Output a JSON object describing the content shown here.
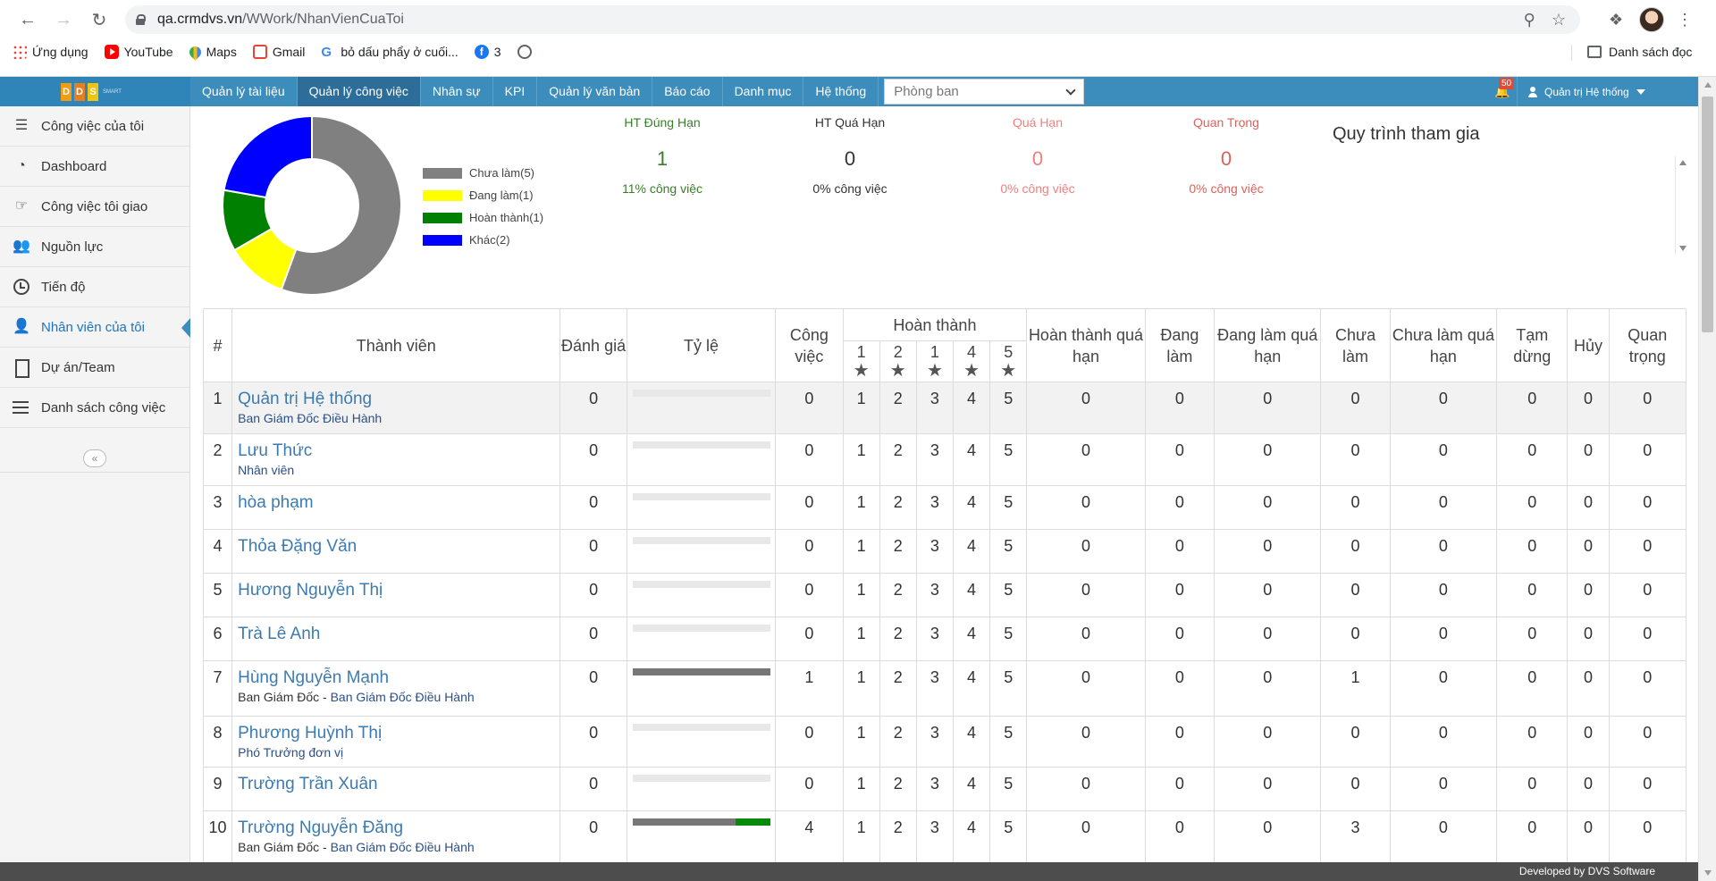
{
  "browser": {
    "url_host": "qa.crmdvs.vn",
    "url_path": "/WWork/NhanVienCuaToi",
    "bookmarks": [
      {
        "label": "Ứng dụng",
        "icon": "apps-icon"
      },
      {
        "label": "YouTube",
        "icon": "youtube-icon"
      },
      {
        "label": "Maps",
        "icon": "maps-icon"
      },
      {
        "label": "Gmail",
        "icon": "gmail-icon"
      },
      {
        "label": "bỏ dấu phẩy ở cuối...",
        "icon": "google-icon"
      },
      {
        "label": "3",
        "icon": "facebook-icon"
      },
      {
        "label": "",
        "icon": "globe-icon"
      }
    ],
    "reading_list": "Danh sách đọc"
  },
  "header": {
    "logo": {
      "letters": [
        "D",
        "D",
        "S"
      ],
      "tagline": "SMART"
    },
    "nav": [
      "Quản lý tài liệu",
      "Quản lý công việc",
      "Nhân sự",
      "KPI",
      "Quản lý văn bản",
      "Báo cáo",
      "Danh mục",
      "Hệ thống"
    ],
    "active_nav": "Quản lý công việc",
    "department_placeholder": "Phòng ban",
    "notification_count": "50",
    "user": "Quản trị Hệ thống",
    "accent_color": "#3c8dbc"
  },
  "sidebar": {
    "items": [
      {
        "label": "Công việc của tôi",
        "icon": "task-list-icon"
      },
      {
        "label": "Dashboard",
        "icon": "pie-chart-icon"
      },
      {
        "label": "Công việc tôi giao",
        "icon": "hand-point-icon"
      },
      {
        "label": "Nguồn lực",
        "icon": "users-icon"
      },
      {
        "label": "Tiến độ",
        "icon": "clock-icon"
      },
      {
        "label": "Nhân viên của tôi",
        "icon": "user-icon"
      },
      {
        "label": "Dự án/Team",
        "icon": "building-icon"
      },
      {
        "label": "Danh sách công việc",
        "icon": "list-icon"
      }
    ],
    "active": "Nhân viên của tôi"
  },
  "summary": {
    "chart_data": {
      "type": "pie",
      "donut": true,
      "categories": [
        "Chưa làm",
        "Đang làm",
        "Hoàn thành",
        "Khác"
      ],
      "values": [
        5,
        1,
        1,
        2
      ],
      "legend": [
        "Chưa làm(5)",
        "Đang làm(1)",
        "Hoàn thành(1)",
        "Khác(2)"
      ],
      "colors": [
        "#808080",
        "#ffff00",
        "#008000",
        "#0000ff"
      ],
      "legend_position": "right"
    },
    "stats": [
      {
        "label": "HT Đúng Hạn",
        "value": "1",
        "sub": "11% công việc",
        "color": "#3a7d2c"
      },
      {
        "label": "HT Quá Hạn",
        "value": "0",
        "sub": "0% công việc",
        "color": "#333333"
      },
      {
        "label": "Quá Hạn",
        "value": "0",
        "sub": "0% công việc",
        "color": "#f08080"
      },
      {
        "label": "Quan Trọng",
        "value": "0",
        "sub": "0% công việc",
        "color": "#e0605a"
      }
    ],
    "flow_title": "Quy trình tham gia"
  },
  "table": {
    "headers": {
      "index": "#",
      "member": "Thành viên",
      "rating": "Đánh giá",
      "ratio": "Tỷ lệ",
      "tasks": "Công việc",
      "completed": "Hoàn thành",
      "completed_late": "Hoàn thành quá hạn",
      "in_progress": "Đang làm",
      "in_progress_late": "Đang làm quá hạn",
      "not_started": "Chưa làm",
      "not_started_late": "Chưa làm quá hạn",
      "paused": "Tạm dừng",
      "cancelled": "Hủy",
      "important": "Quan trọng",
      "star_levels": [
        "1",
        "2",
        "1",
        "4",
        "5"
      ]
    },
    "rows": [
      {
        "idx": "1",
        "name": "Quản trị Hệ thống",
        "sub_pre": "",
        "sub_dept": "Ban Giám Đốc Điều Hành",
        "rating": "0",
        "ratio_grey": 0,
        "ratio_green": 0,
        "tasks": "0",
        "s1": "1",
        "s2": "2",
        "s3": "3",
        "s4": "4",
        "s5": "5",
        "late_done": "0",
        "doing": "0",
        "doing_late": "0",
        "todo": "0",
        "todo_late": "0",
        "paused": "0",
        "cancel": "0",
        "important": "0"
      },
      {
        "idx": "2",
        "name": "Lưu Thức",
        "sub_pre": "",
        "sub_dept": "Nhân viên",
        "rating": "0",
        "ratio_grey": 0,
        "ratio_green": 0,
        "tasks": "0",
        "s1": "1",
        "s2": "2",
        "s3": "3",
        "s4": "4",
        "s5": "5",
        "late_done": "0",
        "doing": "0",
        "doing_late": "0",
        "todo": "0",
        "todo_late": "0",
        "paused": "0",
        "cancel": "0",
        "important": "0"
      },
      {
        "idx": "3",
        "name": "hòa phạm",
        "sub_pre": "",
        "sub_dept": "",
        "rating": "0",
        "ratio_grey": 0,
        "ratio_green": 0,
        "tasks": "0",
        "s1": "1",
        "s2": "2",
        "s3": "3",
        "s4": "4",
        "s5": "5",
        "late_done": "0",
        "doing": "0",
        "doing_late": "0",
        "todo": "0",
        "todo_late": "0",
        "paused": "0",
        "cancel": "0",
        "important": "0"
      },
      {
        "idx": "4",
        "name": "Thỏa Đặng Văn",
        "sub_pre": "",
        "sub_dept": "",
        "rating": "0",
        "ratio_grey": 0,
        "ratio_green": 0,
        "tasks": "0",
        "s1": "1",
        "s2": "2",
        "s3": "3",
        "s4": "4",
        "s5": "5",
        "late_done": "0",
        "doing": "0",
        "doing_late": "0",
        "todo": "0",
        "todo_late": "0",
        "paused": "0",
        "cancel": "0",
        "important": "0"
      },
      {
        "idx": "5",
        "name": "Hương Nguyễn Thị",
        "sub_pre": "",
        "sub_dept": "",
        "rating": "0",
        "ratio_grey": 0,
        "ratio_green": 0,
        "tasks": "0",
        "s1": "1",
        "s2": "2",
        "s3": "3",
        "s4": "4",
        "s5": "5",
        "late_done": "0",
        "doing": "0",
        "doing_late": "0",
        "todo": "0",
        "todo_late": "0",
        "paused": "0",
        "cancel": "0",
        "important": "0"
      },
      {
        "idx": "6",
        "name": "Trà Lê Anh",
        "sub_pre": "",
        "sub_dept": "",
        "rating": "0",
        "ratio_grey": 0,
        "ratio_green": 0,
        "tasks": "0",
        "s1": "1",
        "s2": "2",
        "s3": "3",
        "s4": "4",
        "s5": "5",
        "late_done": "0",
        "doing": "0",
        "doing_late": "0",
        "todo": "0",
        "todo_late": "0",
        "paused": "0",
        "cancel": "0",
        "important": "0"
      },
      {
        "idx": "7",
        "name": "Hùng Nguyễn Mạnh",
        "sub_pre": "Ban Giám Đốc - ",
        "sub_dept": "Ban Giám Đốc Điều Hành",
        "rating": "0",
        "ratio_grey": 1,
        "ratio_green": 0,
        "tasks": "1",
        "s1": "1",
        "s2": "2",
        "s3": "3",
        "s4": "4",
        "s5": "5",
        "late_done": "0",
        "doing": "0",
        "doing_late": "0",
        "todo": "1",
        "todo_late": "0",
        "paused": "0",
        "cancel": "0",
        "important": "0"
      },
      {
        "idx": "8",
        "name": "Phương Huỳnh Thị",
        "sub_pre": "",
        "sub_dept": "Phó Trưởng đơn vị",
        "rating": "0",
        "ratio_grey": 0,
        "ratio_green": 0,
        "tasks": "0",
        "s1": "1",
        "s2": "2",
        "s3": "3",
        "s4": "4",
        "s5": "5",
        "late_done": "0",
        "doing": "0",
        "doing_late": "0",
        "todo": "0",
        "todo_late": "0",
        "paused": "0",
        "cancel": "0",
        "important": "0"
      },
      {
        "idx": "9",
        "name": "Trường Trần Xuân",
        "sub_pre": "",
        "sub_dept": "",
        "rating": "0",
        "ratio_grey": 0,
        "ratio_green": 0,
        "tasks": "0",
        "s1": "1",
        "s2": "2",
        "s3": "3",
        "s4": "4",
        "s5": "5",
        "late_done": "0",
        "doing": "0",
        "doing_late": "0",
        "todo": "0",
        "todo_late": "0",
        "paused": "0",
        "cancel": "0",
        "important": "0"
      },
      {
        "idx": "10",
        "name": "Trường Nguyễn Đăng",
        "sub_pre": "Ban Giám Đốc - ",
        "sub_dept": "Ban Giám Đốc Điều Hành",
        "rating": "0",
        "ratio_grey": 0.75,
        "ratio_green": 0.25,
        "tasks": "4",
        "s1": "1",
        "s2": "2",
        "s3": "3",
        "s4": "4",
        "s5": "5",
        "late_done": "0",
        "doing": "0",
        "doing_late": "0",
        "todo": "3",
        "todo_late": "0",
        "paused": "0",
        "cancel": "0",
        "important": "0"
      }
    ]
  },
  "footer": "Developed by DVS Software"
}
